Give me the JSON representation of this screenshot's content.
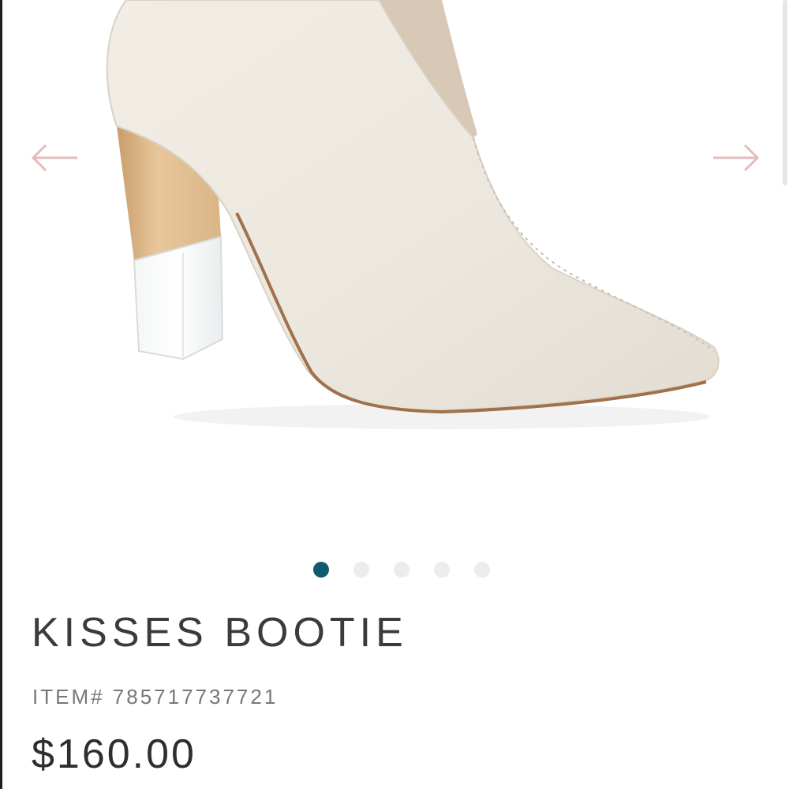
{
  "product": {
    "title": "KISSES BOOTIE",
    "item_number": "ITEM# 785717737721",
    "price": "$160.00"
  },
  "carousel": {
    "total_images": 5,
    "active_index": 0,
    "prev_icon": "arrow-left-icon",
    "next_icon": "arrow-right-icon"
  },
  "colors": {
    "arrow": "#e4bcbc",
    "active_dot": "#0f5a6e",
    "inactive_dot": "#ececec",
    "title_text": "#3b3b3b",
    "subtext": "#777777"
  }
}
